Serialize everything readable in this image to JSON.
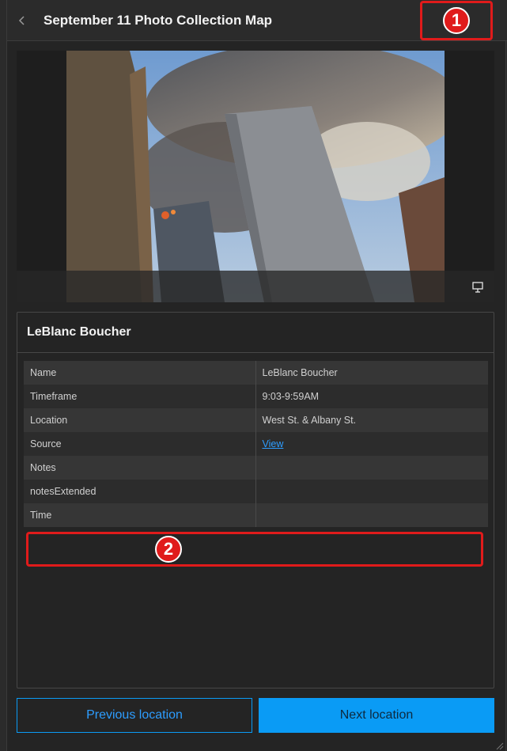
{
  "header": {
    "title": "September 11 Photo Collection Map"
  },
  "media": {
    "icon": "presentation-icon"
  },
  "card": {
    "title": "LeBlanc Boucher",
    "rows": [
      {
        "key": "Name",
        "value": "LeBlanc Boucher"
      },
      {
        "key": "Timeframe",
        "value": "9:03-9:59AM"
      },
      {
        "key": "Location",
        "value": "West St. & Albany St."
      },
      {
        "key": "Source",
        "value": "View"
      },
      {
        "key": "Notes",
        "value": ""
      },
      {
        "key": "notesExtended",
        "value": ""
      },
      {
        "key": "Time",
        "value": ""
      }
    ]
  },
  "footer": {
    "prev_label": "Previous location",
    "next_label": "Next location"
  },
  "annotations": {
    "badge1": "1",
    "badge2": "2"
  },
  "colors": {
    "accent": "#0a9bf5",
    "annotation": "#e01b1b"
  }
}
